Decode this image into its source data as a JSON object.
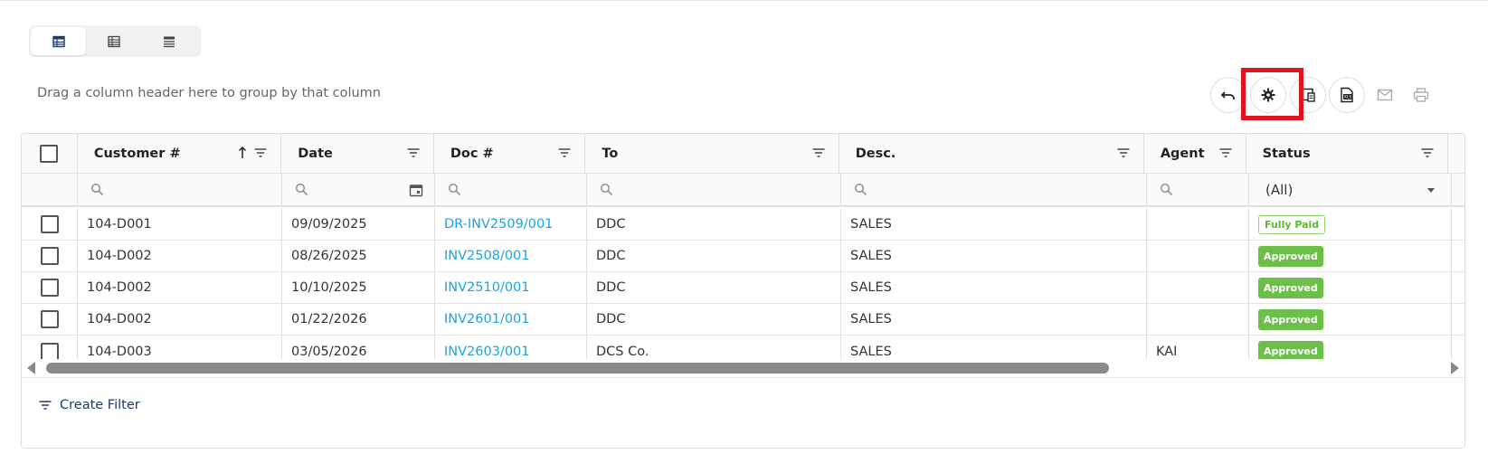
{
  "view_modes": [
    {
      "icon": "table-view-icon",
      "active": true
    },
    {
      "icon": "grid-view-icon",
      "active": false
    },
    {
      "icon": "list-view-icon",
      "active": false
    }
  ],
  "group_hint": "Drag a column header here to group by that column",
  "toolbar": {
    "icons": [
      "undo-icon",
      "settings-gear-icon",
      "column-chooser-icon",
      "export-excel-icon",
      "email-icon",
      "print-icon"
    ],
    "highlighted": "settings-gear-icon",
    "highlight_color": "#e0141e"
  },
  "columns": [
    {
      "label": "Customer #",
      "sorted": "asc"
    },
    {
      "label": "Date"
    },
    {
      "label": "Doc #"
    },
    {
      "label": "To"
    },
    {
      "label": "Desc."
    },
    {
      "label": "Agent"
    },
    {
      "label": "Status"
    }
  ],
  "filter_row": {
    "status_select": "(All)"
  },
  "rows": [
    {
      "customer": "104-D001",
      "date": "09/09/2025",
      "doc": "DR-INV2509/001",
      "to": "DDC",
      "desc": "SALES",
      "agent": "",
      "status": "Fully Paid"
    },
    {
      "customer": "104-D002",
      "date": "08/26/2025",
      "doc": "INV2508/001",
      "to": "DDC",
      "desc": "SALES",
      "agent": "",
      "status": "Approved"
    },
    {
      "customer": "104-D002",
      "date": "10/10/2025",
      "doc": "INV2510/001",
      "to": "DDC",
      "desc": "SALES",
      "agent": "",
      "status": "Approved"
    },
    {
      "customer": "104-D002",
      "date": "01/22/2026",
      "doc": "INV2601/001",
      "to": "DDC",
      "desc": "SALES",
      "agent": "",
      "status": "Approved"
    },
    {
      "customer": "104-D003",
      "date": "03/05/2026",
      "doc": "INV2603/001",
      "to": "DCS Co.",
      "desc": "SALES",
      "agent": "KAI",
      "status": "Approved"
    }
  ],
  "footer": {
    "create_filter_label": "Create Filter"
  },
  "colors": {
    "link": "#1aa3e6",
    "approved_bg": "#6cc04a",
    "paid_border": "#8fd56a",
    "accent_dark": "#1c3a6e"
  }
}
